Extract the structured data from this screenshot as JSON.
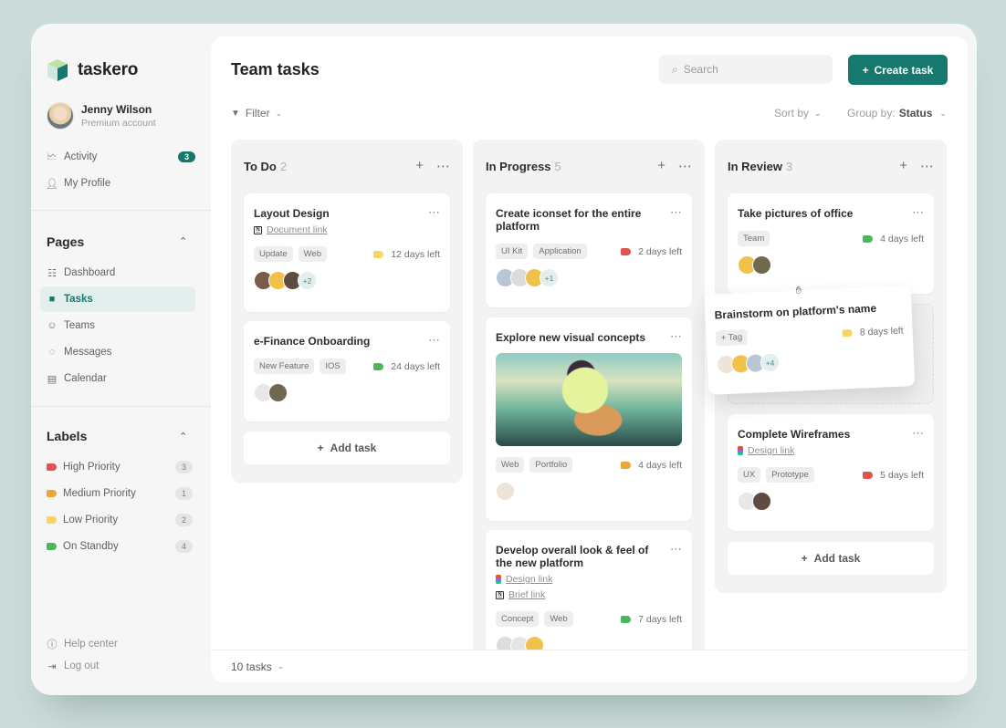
{
  "app": {
    "name": "taskero"
  },
  "user": {
    "name": "Jenny Wilson",
    "plan": "Premium account"
  },
  "top_nav": [
    {
      "label": "Activity",
      "icon": "activity-icon",
      "badge": "3"
    },
    {
      "label": "My Profile",
      "icon": "user-icon"
    }
  ],
  "pages": {
    "title": "Pages",
    "items": [
      {
        "label": "Dashboard",
        "icon": "grid-icon",
        "active": false
      },
      {
        "label": "Tasks",
        "icon": "document-icon",
        "active": true
      },
      {
        "label": "Teams",
        "icon": "team-icon",
        "active": false
      },
      {
        "label": "Messages",
        "icon": "chat-icon",
        "active": false
      },
      {
        "label": "Calendar",
        "icon": "calendar-icon",
        "active": false
      }
    ]
  },
  "labels": {
    "title": "Labels",
    "items": [
      {
        "label": "High Priority",
        "count": "3",
        "color": "#e0534f"
      },
      {
        "label": "Medium Priority",
        "count": "1",
        "color": "#eda43a"
      },
      {
        "label": "Low Priority",
        "count": "2",
        "color": "#f5d660"
      },
      {
        "label": "On Standby",
        "count": "4",
        "color": "#4cb65a"
      }
    ]
  },
  "bottom_nav": [
    {
      "label": "Help center",
      "icon": "info-icon"
    },
    {
      "label": "Log out",
      "icon": "logout-icon"
    }
  ],
  "header": {
    "title": "Team tasks",
    "search_placeholder": "Search",
    "create_label": "Create task"
  },
  "toolbar": {
    "filter": "Filter",
    "sort": "Sort by",
    "group_prefix": "Group by:",
    "group_value": "Status"
  },
  "columns": [
    {
      "name": "To Do",
      "count": "2",
      "add_label": "Add task",
      "cards": [
        {
          "title": "Layout Design",
          "links": [
            {
              "type": "notion",
              "label": "Document link"
            }
          ],
          "tags": [
            "Update",
            "Web"
          ],
          "due": "12 days left",
          "due_color": "#f5d660",
          "extra": "+2"
        },
        {
          "title": "e-Finance Onboarding",
          "links": [],
          "tags": [
            "New Feature",
            "IOS"
          ],
          "due": "24 days left",
          "due_color": "#4cb65a",
          "extra": ""
        }
      ]
    },
    {
      "name": "In Progress",
      "count": "5",
      "cards": [
        {
          "title": "Create iconset for the entire platform",
          "links": [],
          "tags": [
            "UI Kit",
            "Application"
          ],
          "due": "2 days left",
          "due_color": "#e0534f",
          "extra": "+1"
        },
        {
          "title": "Explore new visual concepts",
          "links": [],
          "tags": [
            "Web",
            "Portfolio"
          ],
          "due": "4 days left",
          "due_color": "#eda43a",
          "extra": ""
        },
        {
          "title": "Develop overall look & feel of the new platform",
          "links": [
            {
              "type": "figma",
              "label": "Design link"
            },
            {
              "type": "notion",
              "label": "Brief link"
            }
          ],
          "tags": [
            "Concept",
            "Web"
          ],
          "due": "7 days left",
          "due_color": "#4cb65a",
          "extra": ""
        }
      ]
    },
    {
      "name": "In Review",
      "count": "3",
      "add_label": "Add task",
      "cards": [
        {
          "title": "Take pictures of office",
          "links": [],
          "tags": [
            "Team"
          ],
          "due": "4 days left",
          "due_color": "#4cb65a",
          "extra": ""
        },
        {
          "title": "Complete Wireframes",
          "links": [
            {
              "type": "figma",
              "label": "Design link"
            }
          ],
          "tags": [
            "UX",
            "Prototype"
          ],
          "due": "5 days left",
          "due_color": "#e0534f",
          "extra": ""
        }
      ]
    }
  ],
  "dragging_card": {
    "title": "Brainstorm on platform's name",
    "tag_label": "Tag",
    "due": "8 days left",
    "due_color": "#f5d660",
    "extra": "+4"
  },
  "footer": {
    "tasks_count": "10 tasks"
  },
  "colors": {
    "accent": "#16786e"
  }
}
